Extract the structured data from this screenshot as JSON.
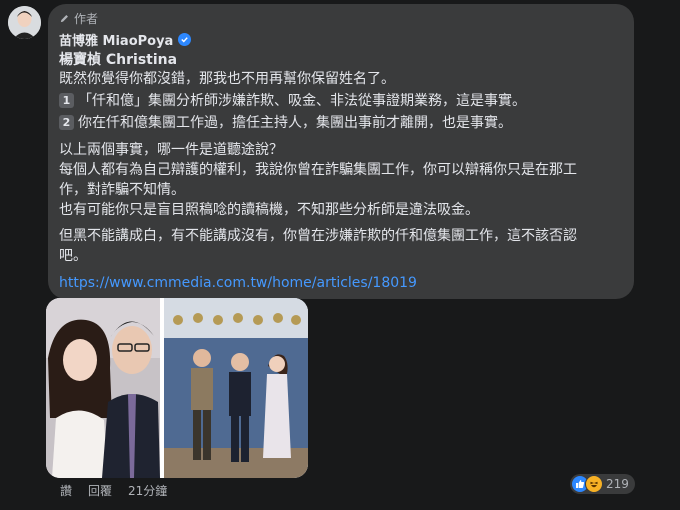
{
  "comment": {
    "badge": "作者",
    "author_name": "苗博雅 MiaoPoya",
    "mention": "楊寶楨 Christina",
    "lines": {
      "l1": "既然你覺得你都沒錯，那我也不用再幫你保留姓名了。",
      "n1": "1",
      "l2": "「仟和億」集團分析師涉嫌詐欺、吸金、非法從事證期業務，這是事實。",
      "n2": "2",
      "l3": "你在仟和億集團工作過，擔任主持人，集團出事前才離開，也是事實。",
      "l4": "以上兩個事實，哪一件是道聽途說？",
      "l5": "每個人都有為自己辯護的權利，我說你曾在詐騙集團工作，你可以辯稱你只是在那工",
      "l6": "作，對詐騙不知情。",
      "l7": "也有可能你只是盲目照稿唸的讀稿機，不知那些分析師是違法吸金。",
      "l8": "但黑不能講成白，有不能講成沒有，你曾在涉嫌詐欺的仟和億集團工作，這不該否認",
      "l9": "吧。"
    },
    "link": "https://www.cmmedia.com.tw/home/articles/18019",
    "actions": {
      "like": "讚",
      "reply": "回覆",
      "time": "21分鐘"
    },
    "reaction_count": "219"
  },
  "colors": {
    "bubble": "#3a3b3c",
    "background": "#18191a",
    "link": "#4599ff",
    "verified": "#2d88ff"
  }
}
